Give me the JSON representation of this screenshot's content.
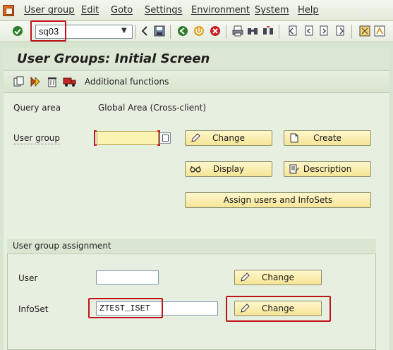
{
  "menubar": {
    "items": [
      "User group",
      "Edit",
      "Goto",
      "Settings",
      "Environment",
      "System",
      "Help"
    ]
  },
  "toolbar": {
    "command_value": "sq03",
    "icons": [
      "enter-icon",
      "back-icon",
      "save-icon",
      "green-back-icon",
      "exit-icon",
      "cancel-icon",
      "print-icon",
      "find-icon",
      "find-next-icon",
      "first-page-icon",
      "prev-page-icon",
      "next-page-icon",
      "last-page-icon",
      "layout-icon",
      "help-icon"
    ]
  },
  "title": "User Groups: Initial Screen",
  "app_toolbar": {
    "additional_functions": "Additional functions"
  },
  "form": {
    "query_area_label": "Query area",
    "query_area_value": "Global Area (Cross-client)",
    "user_group_label": "User group",
    "user_group_value": "",
    "buttons": {
      "change": "Change",
      "create": "Create",
      "display": "Display",
      "description": "Description",
      "assign": "Assign users and InfoSets"
    }
  },
  "assignment": {
    "title": "User group assignment",
    "user_label": "User",
    "user_value": "",
    "user_change": "Change",
    "infoset_label": "InfoSet",
    "infoset_value": "ZTEST_ISET",
    "infoset_change": "Change"
  },
  "colors": {
    "highlight": "#c0141c",
    "button_bg": "#f5e596",
    "background": "#e6efe0"
  }
}
